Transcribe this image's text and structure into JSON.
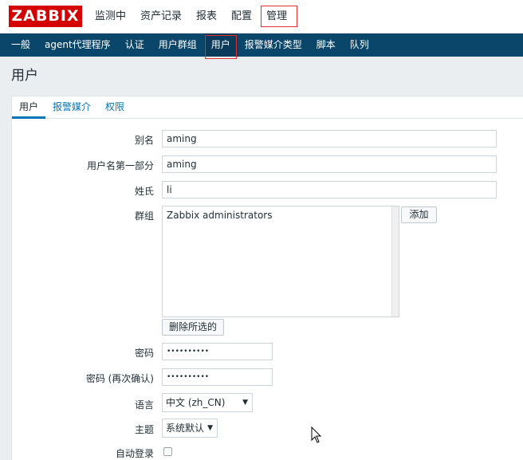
{
  "logo": "ZABBIX",
  "top_nav": [
    "监测中",
    "资产记录",
    "报表",
    "配置",
    "管理"
  ],
  "sub_nav": [
    "一般",
    "agent代理程序",
    "认证",
    "用户群组",
    "用户",
    "报警媒介类型",
    "脚本",
    "队列"
  ],
  "page_title": "用户",
  "tabs": [
    "用户",
    "报警媒介",
    "权限"
  ],
  "form": {
    "alias_label": "别名",
    "alias_value": "aming",
    "name_label": "用户名第一部分",
    "name_value": "aming",
    "surname_label": "姓氏",
    "surname_value": "li",
    "groups_label": "群组",
    "groups_items": [
      "Zabbix administrators"
    ],
    "add_button": "添加",
    "remove_button": "删除所选的",
    "password_label": "密码",
    "password_value": "••••••••••",
    "password2_label": "密码 (再次确认)",
    "password2_value": "••••••••••",
    "language_label": "语言",
    "language_value": "中文 (zh_CN)",
    "theme_label": "主题",
    "theme_value": "系统默认",
    "autologin_label": "自动登录"
  }
}
